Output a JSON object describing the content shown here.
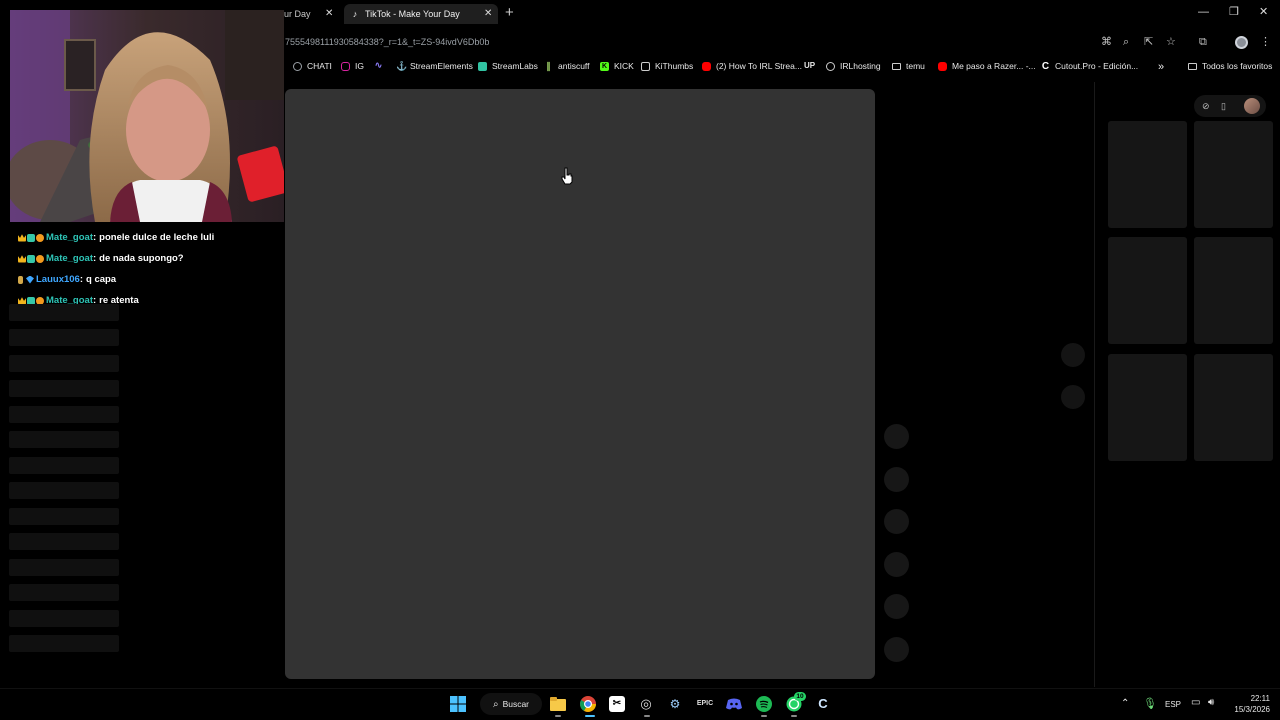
{
  "browser": {
    "tabs": [
      {
        "title": "ur Day"
      },
      {
        "title": "TikTok - Make Your Day",
        "favicon": "tiktok-icon"
      }
    ],
    "url": "7555498111930584338?_r=1&_t=ZS-94ivdV6Db0b",
    "bookmarks": [
      {
        "label": "CHATI",
        "icon": "chati-icon",
        "color": "#9aa0a6"
      },
      {
        "label": "IG",
        "icon": "instagram-icon",
        "color": "#d6249f"
      },
      {
        "label": "",
        "icon": "chart-icon",
        "color": "#8b7cf6"
      },
      {
        "label": "StreamElements",
        "icon": "streamelements-icon",
        "color": "#ffffff"
      },
      {
        "label": "StreamLabs",
        "icon": "streamlabs-icon",
        "color": "#31c3a2"
      },
      {
        "label": "antiscuff",
        "icon": "antiscuff-icon",
        "color": "#9ccc65"
      },
      {
        "label": "KICK",
        "icon": "kick-icon",
        "color": "#53fc18"
      },
      {
        "label": "KiThumbs",
        "icon": "kithumbs-icon",
        "color": "#cccccc"
      },
      {
        "label": "(2) How To IRL Strea...",
        "icon": "youtube-icon",
        "color": "#ff0000"
      },
      {
        "label": "",
        "icon": "up-icon",
        "color": "#ffffff"
      },
      {
        "label": "IRLhosting",
        "icon": "globe-icon",
        "color": "#cccccc"
      },
      {
        "label": "temu",
        "icon": "folder-icon",
        "color": "#cccccc"
      },
      {
        "label": "Me paso a Razer... -...",
        "icon": "youtube-icon",
        "color": "#ff0000"
      },
      {
        "label": "Cutout.Pro - Edición...",
        "icon": "cutout-icon",
        "color": "#ffffff"
      }
    ],
    "bookmarks_more": "»",
    "all_bookmarks": "Todos los favoritos",
    "up_glyph": "UP"
  },
  "chat": {
    "messages": [
      {
        "user": "Mate_goat",
        "text": "ponele dulce de leche luli",
        "color": "#2ec4b6"
      },
      {
        "user": "Mate_goat",
        "text": "de nada supongo?",
        "color": "#2ec4b6"
      },
      {
        "user": "Lauux106",
        "text": "q capa",
        "color": "#3fa7ff"
      },
      {
        "user": "Mate_goat",
        "text": "re atenta",
        "color": "#2ec4b6"
      }
    ]
  },
  "taskbar": {
    "search_label": "Buscar",
    "language": "ESP",
    "time": "22:11",
    "date": "15/3/2026",
    "whatsapp_badge": "10"
  },
  "colors": {
    "player_bg": "#333333",
    "page_bg": "#000000"
  }
}
